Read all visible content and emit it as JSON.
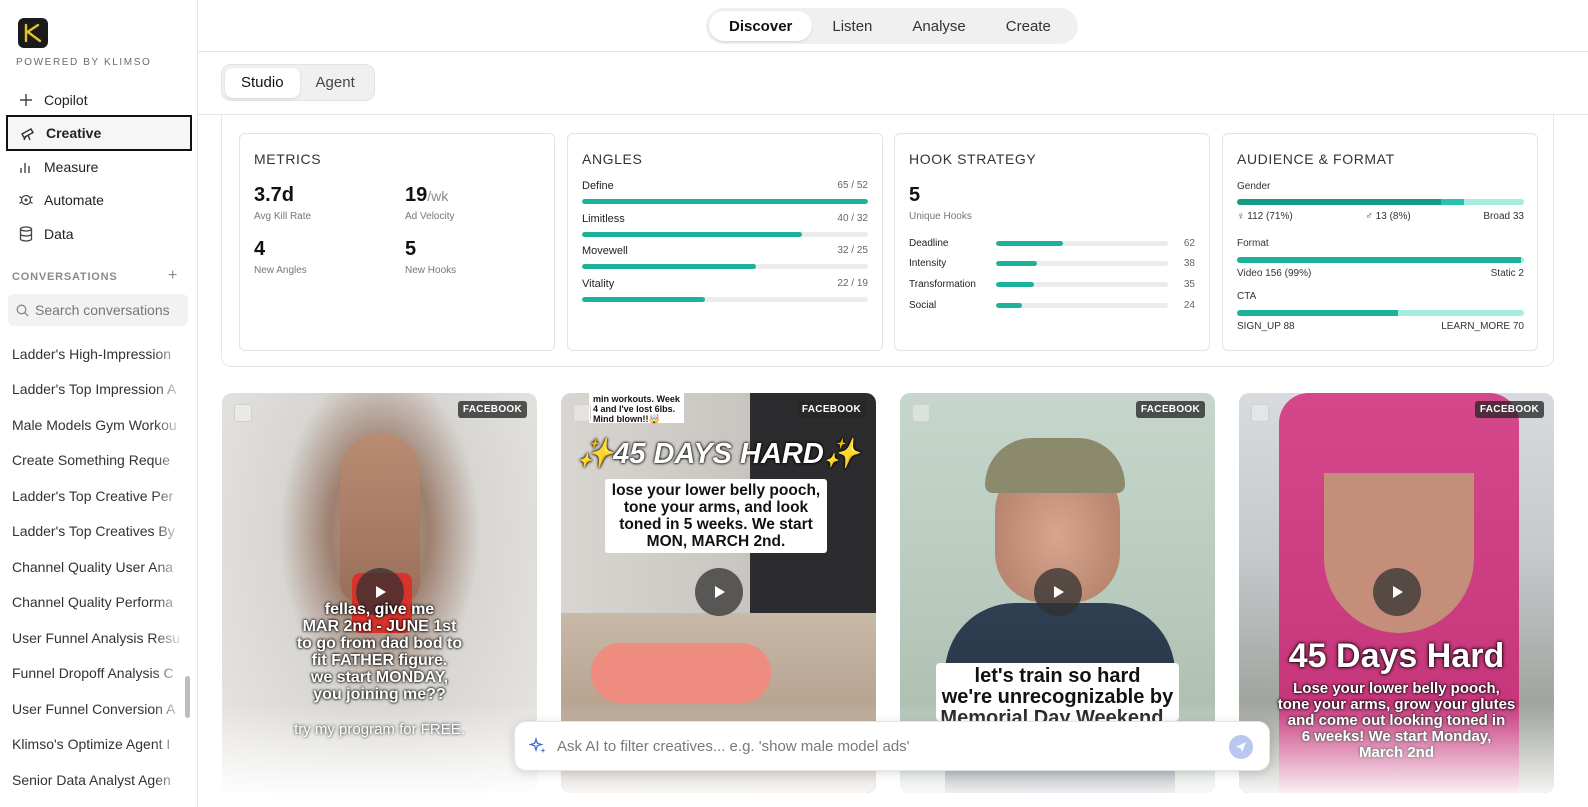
{
  "brand": {
    "powered_by": "POWERED BY KLIMSO"
  },
  "nav": [
    {
      "label": "Copilot",
      "icon": "plus-icon"
    },
    {
      "label": "Creative",
      "icon": "telescope-icon",
      "active": true
    },
    {
      "label": "Measure",
      "icon": "bar-chart-icon"
    },
    {
      "label": "Automate",
      "icon": "robot-icon"
    },
    {
      "label": "Data",
      "icon": "database-icon"
    }
  ],
  "conversations": {
    "heading": "CONVERSATIONS",
    "search_placeholder": "Search conversations",
    "items": [
      "Ladder's High-Impression",
      "Ladder's Top Impression A",
      "Male Models Gym Workou",
      "Create Something Reque",
      "Ladder's Top Creative Per",
      "Ladder's Top Creatives By",
      "Channel Quality User Ana",
      "Channel Quality Performa",
      "User Funnel Analysis Resu",
      "Funnel Dropoff Analysis C",
      "User Funnel Conversion A",
      "Klimso's Optimize Agent I",
      "Senior Data Analyst Agen"
    ]
  },
  "top_tabs": [
    "Discover",
    "Listen",
    "Analyse",
    "Create"
  ],
  "top_tab_active": "Discover",
  "sub_tabs": [
    "Studio",
    "Agent"
  ],
  "sub_tab_active": "Studio",
  "metrics": {
    "title": "METRICS",
    "kill_rate": {
      "value": "3.7d",
      "label": "Avg Kill Rate"
    },
    "ad_velocity": {
      "value": "19",
      "unit": "/wk",
      "label": "Ad Velocity"
    },
    "new_angles": {
      "value": "4",
      "label": "New Angles"
    },
    "new_hooks": {
      "value": "5",
      "label": "New Hooks"
    }
  },
  "angles": {
    "title": "ANGLES",
    "rows": [
      {
        "name": "Define",
        "value": "65 / 52",
        "fill": 1.0
      },
      {
        "name": "Limitless",
        "value": "40 / 32",
        "fill": 0.77
      },
      {
        "name": "Movewell",
        "value": "32 / 25",
        "fill": 0.61
      },
      {
        "name": "Vitality",
        "value": "22 / 19",
        "fill": 0.43
      }
    ]
  },
  "hooks": {
    "title": "HOOK STRATEGY",
    "unique_count": "5",
    "unique_label": "Unique Hooks",
    "rows": [
      {
        "name": "Deadline",
        "value": "62",
        "fill": 0.39
      },
      {
        "name": "Intensity",
        "value": "38",
        "fill": 0.24
      },
      {
        "name": "Transformation",
        "value": "35",
        "fill": 0.22
      },
      {
        "name": "Social",
        "value": "24",
        "fill": 0.15
      }
    ]
  },
  "audience": {
    "title": "AUDIENCE & FORMAT",
    "gender_label": "Gender",
    "female": "♀ 112 (71%)",
    "male": "♂ 13 (8%)",
    "broad": "Broad 33",
    "gender_fill": [
      0.71,
      0.08,
      0.21
    ],
    "format_label": "Format",
    "video": "Video 156 (99%)",
    "static": "Static 2",
    "format_fill": 0.99,
    "cta_label": "CTA",
    "sign_up": "SIGN_UP 88",
    "learn_more": "LEARN_MORE 70",
    "cta_fill": 0.56
  },
  "creatives": [
    {
      "platform": "FACEBOOK",
      "caption": "fellas, give me\nMAR 2nd - JUNE 1st\nto go from dad bod to\nfit FATHER figure.\nwe start MONDAY,\nyou joining me??",
      "footer": "try my program for FREE."
    },
    {
      "platform": "FACEBOOK",
      "top_note": "min workouts. Week\n4 and I've lost 6lbs.\nMind blown!!🤯",
      "headline": "✨45 DAYS HARD✨",
      "caption": "lose your lower belly pooch,\ntone your arms, and look\ntoned in 5 weeks. We start\nMON, MARCH 2nd."
    },
    {
      "platform": "FACEBOOK",
      "caption": "let's train so hard\nwe're unrecognizable by\nMemorial Day Weekend.."
    },
    {
      "platform": "FACEBOOK",
      "headline": "45 Days Hard",
      "caption": "Lose your lower belly pooch,\ntone your arms, grow your glutes\nand come out looking toned in\n6 weeks! We start Monday,\nMarch 2nd"
    }
  ],
  "ai_bar": {
    "placeholder": "Ask AI to filter creatives... e.g. 'show male model ads'"
  },
  "colors": {
    "accent": "#1ab39a",
    "accent_light": "#9be7da",
    "send": "#b9c8f0"
  }
}
